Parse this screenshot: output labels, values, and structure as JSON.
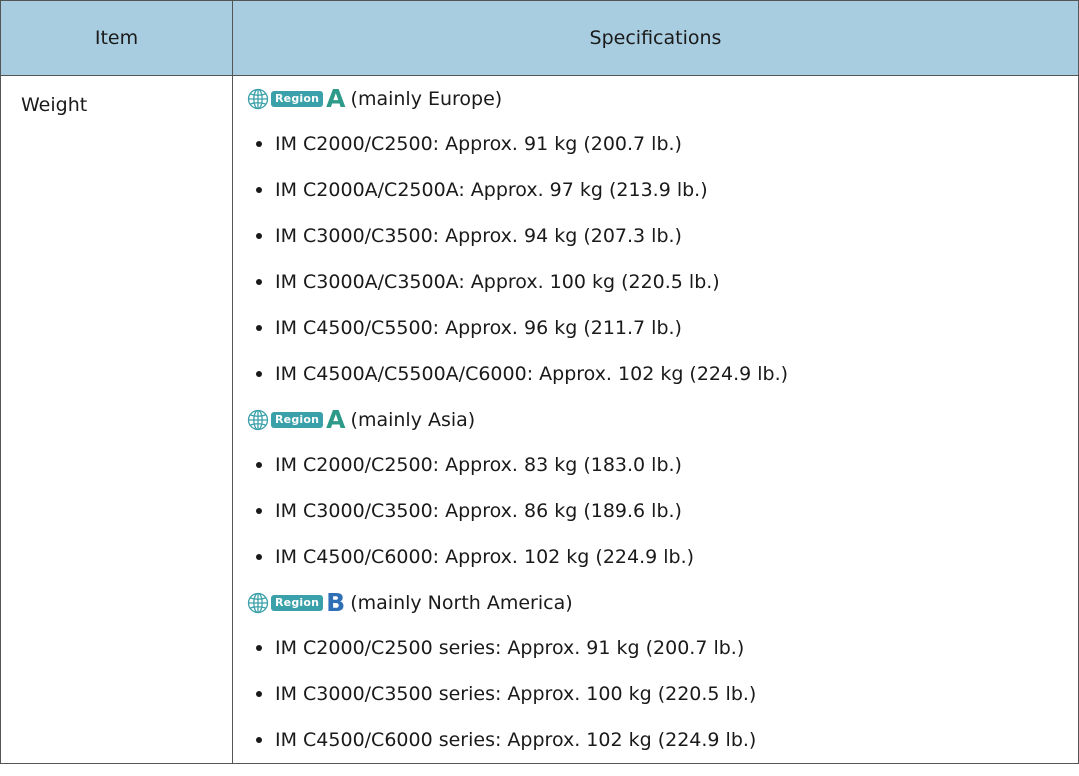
{
  "table": {
    "headers": {
      "item": "Item",
      "specifications": "Specifications"
    },
    "row": {
      "item": "Weight",
      "region_tag_label": "Region",
      "colors": {
        "header_bg": "#a8cde0",
        "region_tag": "#3aa0a9",
        "region_letter_a": "#2e9a8a",
        "region_letter_b": "#2f6fb5"
      },
      "groups": [
        {
          "region_letter": "A",
          "region_note": "(mainly Europe)",
          "items": [
            "IM C2000/C2500: Approx. 91 kg (200.7 lb.)",
            "IM C2000A/C2500A: Approx. 97 kg (213.9 lb.)",
            "IM C3000/C3500: Approx. 94 kg (207.3 lb.)",
            "IM C3000A/C3500A: Approx. 100 kg (220.5 lb.)",
            "IM C4500/C5500: Approx. 96 kg (211.7 lb.)",
            "IM C4500A/C5500A/C6000: Approx. 102 kg (224.9 lb.)"
          ]
        },
        {
          "region_letter": "A",
          "region_note": "(mainly Asia)",
          "items": [
            "IM C2000/C2500: Approx. 83 kg (183.0 lb.)",
            "IM C3000/C3500: Approx. 86 kg (189.6 lb.)",
            "IM C4500/C6000: Approx. 102 kg (224.9 lb.)"
          ]
        },
        {
          "region_letter": "B",
          "region_note": "(mainly North America)",
          "items": [
            "IM C2000/C2500 series: Approx. 91 kg (200.7 lb.)",
            "IM C3000/C3500 series: Approx. 100 kg (220.5 lb.)",
            "IM C4500/C6000 series: Approx. 102 kg (224.9 lb.)"
          ]
        }
      ]
    }
  }
}
